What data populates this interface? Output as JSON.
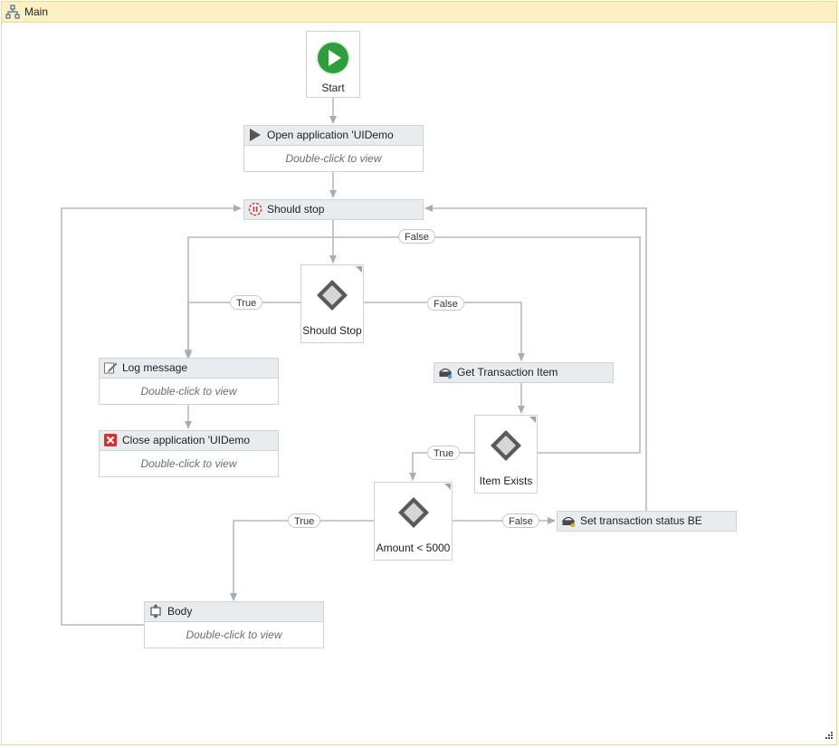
{
  "window": {
    "title": "Main"
  },
  "start": {
    "label": "Start"
  },
  "activities": {
    "open_application": {
      "title": "Open application 'UIDemo",
      "hint": "Double-click to view"
    },
    "should_stop_state": {
      "title": "Should stop"
    },
    "log_message": {
      "title": "Log message",
      "hint": "Double-click to view"
    },
    "close_application": {
      "title": "Close application 'UIDemo",
      "hint": "Double-click to view"
    },
    "get_transaction_item": {
      "title": "Get Transaction Item"
    },
    "set_transaction_status": {
      "title": "Set transaction status BE"
    },
    "body": {
      "title": "Body",
      "hint": "Double-click to view"
    }
  },
  "decisions": {
    "should_stop": {
      "label": "Should Stop"
    },
    "item_exists": {
      "label": "Item Exists"
    },
    "amount_check": {
      "label": "Amount < 5000"
    }
  },
  "edge_labels": {
    "should_stop_false_top": "False",
    "should_stop_true": "True",
    "should_stop_false": "False",
    "item_exists_true": "True",
    "amount_true": "True",
    "amount_false": "False"
  }
}
